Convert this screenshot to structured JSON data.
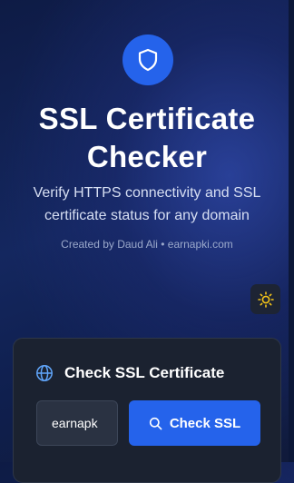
{
  "header": {
    "title": "SSL Certificate Checker",
    "subtitle": "Verify HTTPS connectivity and SSL certificate status for any domain",
    "credit": "Created by Daud Ali • earnapki.com",
    "logo_icon": "shield-icon"
  },
  "theme_toggle": {
    "icon": "sun-icon"
  },
  "card": {
    "title": "Check SSL Certificate",
    "icon": "globe-icon",
    "domain_value": "earnapk",
    "check_button_label": "Check SSL",
    "check_button_icon": "search-icon"
  },
  "colors": {
    "accent": "#2563eb",
    "card_bg": "#1b2230",
    "sun": "#f5c518"
  }
}
